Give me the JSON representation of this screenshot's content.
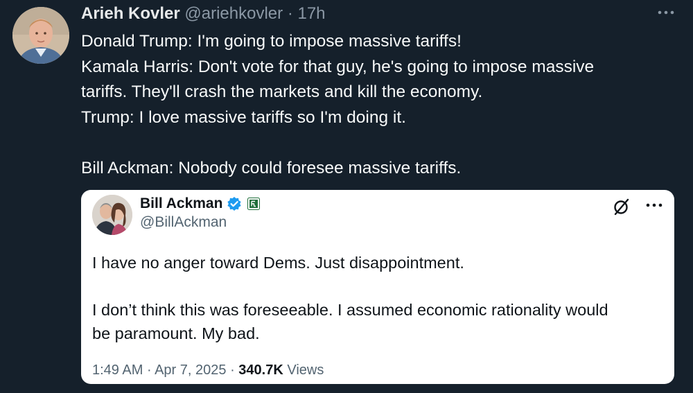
{
  "tweet": {
    "author_name": "Arieh Kovler",
    "handle": "@ariehkovler",
    "separator": "·",
    "time": "17h",
    "text_lines": [
      "Donald Trump: I'm going to impose massive tariffs!",
      "Kamala Harris: Don't vote for that guy, he's going to impose massive",
      "tariffs. They'll crash the markets and kill the economy.",
      "Trump: I love massive tariffs so I'm doing it.",
      "",
      "Bill Ackman: Nobody could foresee massive tariffs."
    ],
    "more_icon": "more-horizontal-icon"
  },
  "quote": {
    "author_name": "Bill Ackman",
    "handle": "@BillAckman",
    "verified_icon": "verified-badge-icon",
    "affiliation_icon": "affiliate-badge-icon",
    "grok_icon": "grok-icon",
    "more_icon": "more-horizontal-icon",
    "text_lines": [
      "I have no anger toward Dems. Just disappointment.",
      "",
      "I don’t think this was foreseeable. I assumed economic rationality would",
      "be paramount. My bad."
    ],
    "time": "1:49 AM",
    "dot1": "·",
    "date": "Apr 7, 2025",
    "dot2": "·",
    "views_count": "340.7K",
    "views_label": "Views"
  },
  "colors": {
    "background": "#15202b",
    "verified_blue": "#1d9bf0",
    "affiliate_green": "#1f6f3a"
  }
}
